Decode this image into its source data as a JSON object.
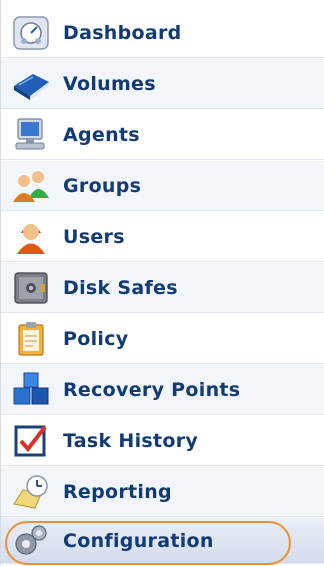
{
  "nav": {
    "items": [
      {
        "label": "Dashboard",
        "icon": "dashboard-icon"
      },
      {
        "label": "Volumes",
        "icon": "volumes-icon"
      },
      {
        "label": "Agents",
        "icon": "agents-icon"
      },
      {
        "label": "Groups",
        "icon": "groups-icon"
      },
      {
        "label": "Users",
        "icon": "users-icon"
      },
      {
        "label": "Disk Safes",
        "icon": "disk-safes-icon"
      },
      {
        "label": "Policy",
        "icon": "policy-icon"
      },
      {
        "label": "Recovery Points",
        "icon": "recovery-points-icon"
      },
      {
        "label": "Task History",
        "icon": "task-history-icon"
      },
      {
        "label": "Reporting",
        "icon": "reporting-icon"
      },
      {
        "label": "Configuration",
        "icon": "configuration-icon",
        "selected": true
      }
    ],
    "colors": {
      "label_text": "#123a73",
      "highlight_ring": "#ef8f2e",
      "selected_background": "#d3dcec"
    }
  }
}
